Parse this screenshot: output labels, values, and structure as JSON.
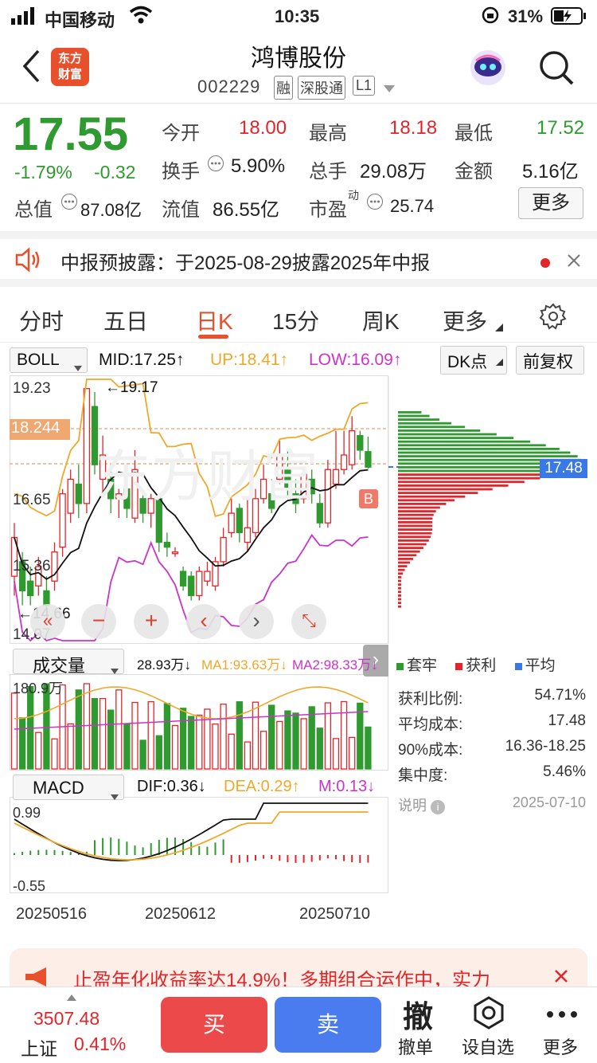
{
  "status": {
    "carrier": "中国移动",
    "time": "10:35",
    "battery": "31%"
  },
  "nav": {
    "logo_line1": "东方",
    "logo_line2": "财富",
    "title": "鸿博股份",
    "code": "002229",
    "badges": [
      "融",
      "深股通",
      "L1"
    ]
  },
  "quote": {
    "price": "17.55",
    "pct": "-1.79%",
    "chg": "-0.32",
    "open_label": "今开",
    "open": "18.00",
    "high_label": "最高",
    "high": "18.18",
    "low_label": "最低",
    "low": "17.52",
    "turnover_label": "换手",
    "turnover": "5.90%",
    "vol_label": "总手",
    "vol": "29.08万",
    "amt_label": "金额",
    "amt": "5.16亿",
    "mcap_label": "总值",
    "mcap": "87.08亿",
    "float_label": "流值",
    "float": "86.55亿",
    "pe_label": "市盈",
    "pe_sup": "动",
    "pe": "25.74",
    "more": "更多"
  },
  "notice": {
    "text": "中报预披露：于2025-08-29披露2025年中报"
  },
  "tabs": [
    "分时",
    "五日",
    "日K",
    "15分",
    "周K",
    "更多"
  ],
  "chart": {
    "indicator": "BOLL",
    "mid": "MID:17.25↑",
    "up": "UP:18.41↑",
    "low": "LOW:16.09↑",
    "dk": "DK点",
    "fq": "前复权",
    "yticks": [
      "19.23",
      "18.244",
      "16.65",
      "15.36",
      "14.07"
    ],
    "max_label": "←19.17",
    "min_label": "←14.66",
    "b_mark": "B",
    "chip_price": "17.48",
    "vol_label": "成交量",
    "vol_val": "28.93万↓",
    "ma1": "MA1:93.63万↓",
    "ma2": "MA2:98.33万↓",
    "vol_tick": "180.9万",
    "macd_label": "MACD",
    "dif": "DIF:0.36↓",
    "dea": "DEA:0.29↑",
    "m": "M:0.13↓",
    "macd_top": "0.99",
    "macd_bot": "-0.55",
    "dates": [
      "20250516",
      "20250612",
      "20250710"
    ]
  },
  "chip": {
    "legend": [
      "套牢",
      "获利",
      "平均"
    ],
    "rows": [
      [
        "获利比例:",
        "54.71%"
      ],
      [
        "平均成本:",
        "17.48"
      ],
      [
        "90%成本:",
        "16.36-18.25"
      ],
      [
        "集中度:",
        "5.46%"
      ]
    ],
    "note": "说明",
    "date": "2025-07-10"
  },
  "banner": {
    "text": "止盈年化收益率达14.9%！多期组合运作中，实力"
  },
  "bottom": {
    "index_val": "3507.48",
    "index_name": "上证",
    "index_pct": "0.41%",
    "buy": "买",
    "sell": "卖",
    "cancel_icon": "撤",
    "cancel": "撤单",
    "watch": "设自选",
    "more": "更多"
  },
  "colors": {
    "up": "#e1262b",
    "down": "#2f9a2f",
    "mid": "#111111",
    "upper": "#f0a82a",
    "lower": "#cc33cc",
    "accent": "#e8502c"
  }
}
